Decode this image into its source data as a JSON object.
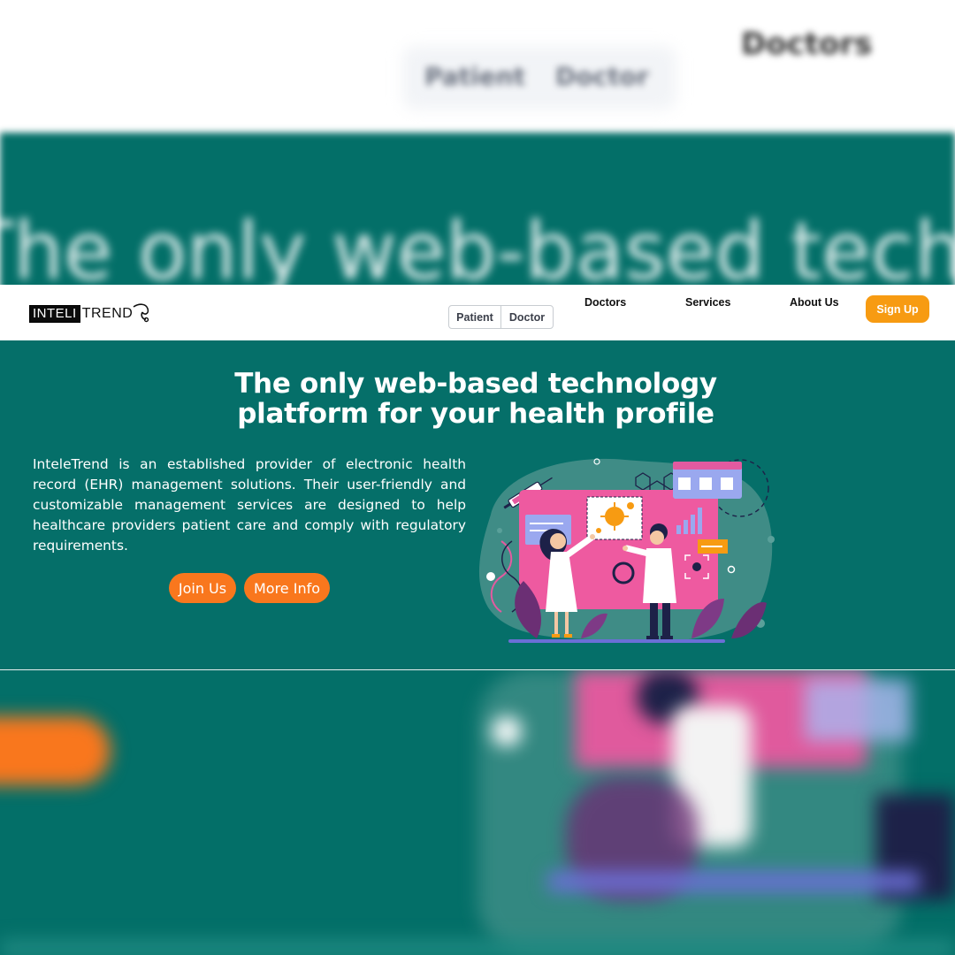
{
  "background": {
    "blurred_top_buttons": [
      "Patient",
      "Doctor"
    ],
    "blurred_top_signup": "Doctors",
    "blurred_headline": "The only web-based technology"
  },
  "navbar": {
    "logo": {
      "boxed_text": "INTELI",
      "rest_text": "TREND"
    },
    "role_toggle": [
      "Patient",
      "Doctor"
    ],
    "links": [
      "Doctors",
      "Services",
      "About Us"
    ],
    "signup_label": "Sign Up"
  },
  "hero": {
    "title_line1": "The only web-based technology",
    "title_line2": "platform for your health profile",
    "description": "InteleTrend is an established provider of electronic health record (EHR) management solutions. Their user-friendly and customizable management services are designed to help healthcare providers patient care and comply with regulatory requirements.",
    "join_label": "Join Us",
    "more_label": "More Info",
    "illustration_icon": "doctors-research-illustration"
  },
  "colors": {
    "teal": "#056f69",
    "signup_orange": "#f79b12",
    "pill_orange": "#f9771d",
    "illustration_pink": "#ee5aa0",
    "illustration_navy": "#1d2148"
  }
}
